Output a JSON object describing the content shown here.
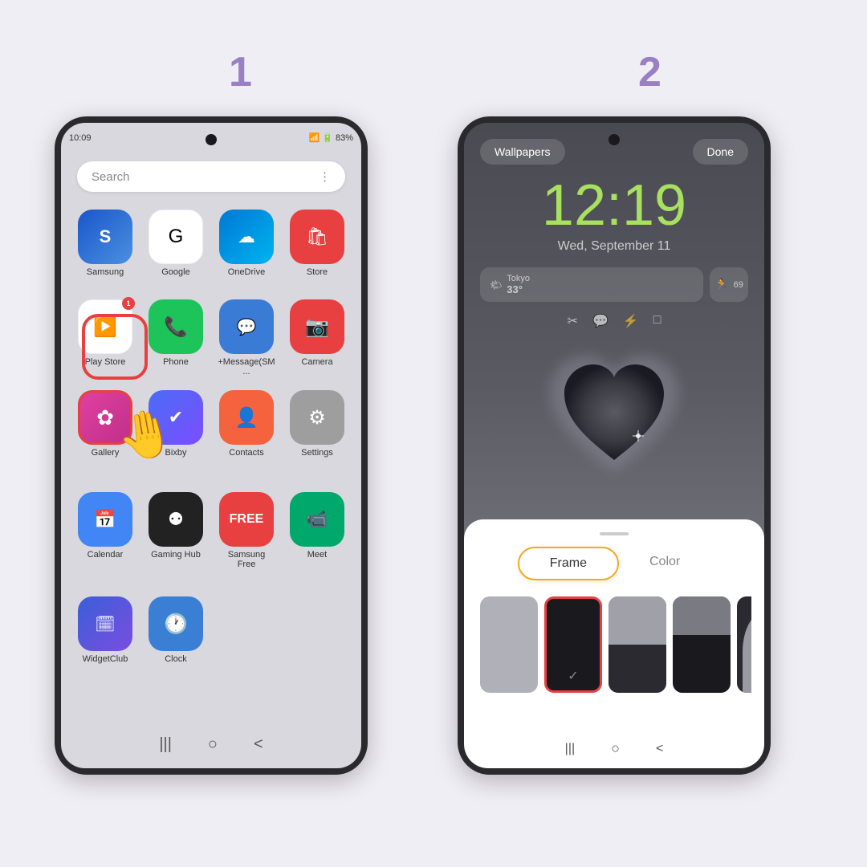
{
  "page": {
    "background": "#f0eef5",
    "step1_label": "1",
    "step2_label": "2"
  },
  "phone1": {
    "status_time": "10:09",
    "status_battery": "83%",
    "search_placeholder": "Search",
    "apps": [
      {
        "name": "Samsung",
        "icon_type": "samsung",
        "label": "Samsung"
      },
      {
        "name": "Google",
        "icon_type": "google",
        "label": "Google"
      },
      {
        "name": "OneDrive",
        "icon_type": "onedrive",
        "label": "OneDrive"
      },
      {
        "name": "Store",
        "icon_type": "store",
        "label": "Store"
      },
      {
        "name": "Play Store",
        "icon_type": "playstore",
        "label": "Play Store",
        "badge": "1"
      },
      {
        "name": "Phone",
        "icon_type": "phone",
        "label": "Phone"
      },
      {
        "name": "+Message",
        "icon_type": "message",
        "label": "+Message(SM..."
      },
      {
        "name": "Camera",
        "icon_type": "camera",
        "label": "Camera"
      },
      {
        "name": "Gallery",
        "icon_type": "gallery",
        "label": "Gallery",
        "highlighted": true
      },
      {
        "name": "Bixby",
        "icon_type": "bixby",
        "label": "Bixby"
      },
      {
        "name": "Contacts",
        "icon_type": "contacts",
        "label": "Contacts"
      },
      {
        "name": "Settings",
        "icon_type": "settings",
        "label": "Settings"
      },
      {
        "name": "Calendar",
        "icon_type": "calendar",
        "label": "Calendar"
      },
      {
        "name": "Gaming Hub",
        "icon_type": "gaminghub",
        "label": "Gaming Hub"
      },
      {
        "name": "Samsung Free",
        "icon_type": "samsungfree",
        "label": "Samsung Free"
      },
      {
        "name": "Meet",
        "icon_type": "meet",
        "label": "Meet"
      },
      {
        "name": "WidgetClub",
        "icon_type": "widgetclub",
        "label": "WidgetClub"
      },
      {
        "name": "Clock",
        "icon_type": "clock",
        "label": "Clock"
      }
    ]
  },
  "phone2": {
    "wallpapers_btn": "Wallpapers",
    "done_btn": "Done",
    "time": "12:19",
    "date": "Wed, September 11",
    "weather_city": "Tokyo",
    "weather_temp": "33°",
    "panel": {
      "frame_tab": "Frame",
      "color_tab": "Color",
      "active_tab": "Frame"
    }
  },
  "nav": {
    "menu_icon": "☰",
    "home_icon": "○",
    "back_icon": "<"
  }
}
